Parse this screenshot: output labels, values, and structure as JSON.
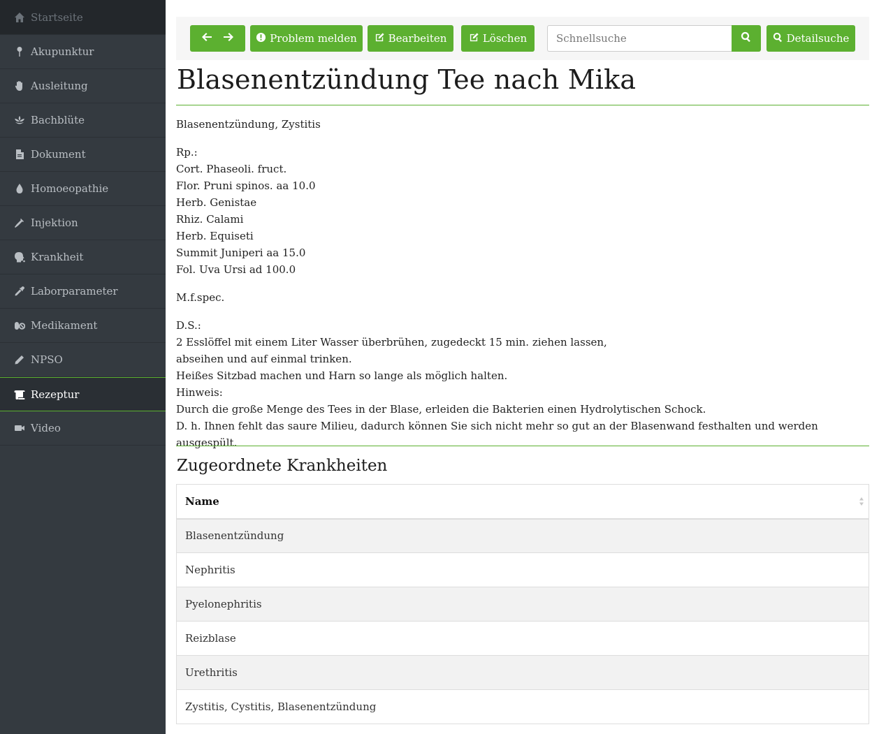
{
  "sidebar": {
    "items": [
      {
        "label": "Startseite",
        "icon": "home-icon"
      },
      {
        "label": "Akupunktur",
        "icon": "needle-pin-icon"
      },
      {
        "label": "Ausleitung",
        "icon": "hand-icon"
      },
      {
        "label": "Bachblüte",
        "icon": "flower-icon"
      },
      {
        "label": "Dokument",
        "icon": "pdf-file-icon"
      },
      {
        "label": "Homoeopathie",
        "icon": "drop-icon"
      },
      {
        "label": "Injektion",
        "icon": "syringe-icon"
      },
      {
        "label": "Krankheit",
        "icon": "sick-head-icon"
      },
      {
        "label": "Laborparameter",
        "icon": "eyedropper-icon"
      },
      {
        "label": "Medikament",
        "icon": "pills-icon"
      },
      {
        "label": "NPSO",
        "icon": "pencil-icon"
      },
      {
        "label": "Rezeptur",
        "icon": "scroll-icon"
      },
      {
        "label": "Video",
        "icon": "video-camera-icon"
      }
    ],
    "active": "Rezeptur"
  },
  "toolbar": {
    "problem_label": "Problem melden",
    "edit_label": "Bearbeiten",
    "delete_label": "Löschen",
    "search_placeholder": "Schnellsuche",
    "detail_label": "Detailsuche"
  },
  "page": {
    "title": "Blasenentzündung Tee nach Mika",
    "paragraphs": [
      [
        "Blasenentzündung, Zystitis"
      ],
      [
        "Rp.:",
        "Cort. Phaseoli. fruct.",
        "Flor. Pruni spinos. aa 10.0",
        "Herb. Genistae",
        "Rhiz. Calami",
        "Herb. Equiseti",
        "Summit Juniperi aa 15.0",
        "Fol. Uva Ursi ad 100.0"
      ],
      [
        "M.f.spec."
      ],
      [
        "D.S.:",
        "2 Esslöffel mit einem Liter Wasser überbrühen, zugedeckt 15 min. ziehen lassen,",
        "abseihen und auf einmal trinken.",
        "Heißes Sitzbad machen und Harn so lange als möglich halten.",
        "Hinweis:",
        "Durch die große Menge des Tees in der Blase, erleiden die Bakterien einen Hydrolytischen Schock.",
        "D. h. Ihnen fehlt das saure Milieu, dadurch können Sie sich nicht mehr so gut an der Blasenwand festhalten und werden ausgespült."
      ]
    ]
  },
  "diseases": {
    "heading": "Zugeordnete Krankheiten",
    "column_name": "Name",
    "rows": [
      "Blasenentzündung",
      "Nephritis",
      "Pyelonephritis",
      "Reizblase",
      "Urethritis",
      "Zystitis, Cystitis, Blasenentzündung"
    ]
  },
  "colors": {
    "accent": "#5cb030",
    "sidebar_bg": "#343a40"
  }
}
